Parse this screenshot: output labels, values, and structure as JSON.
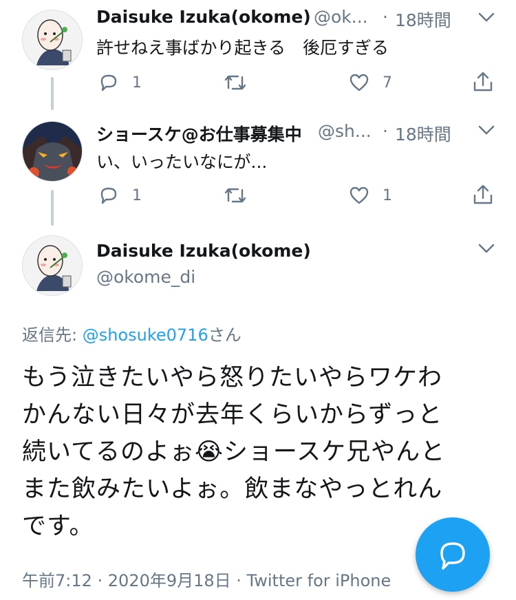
{
  "tweets": [
    {
      "name": "Daisuke Izuka(okome)",
      "handle": "@ok...",
      "time": "18時間",
      "text": "許せねえ事ばかり起きる　後厄すぎる",
      "reply_count": "1",
      "like_count": "7"
    },
    {
      "name": "ショースケ@お仕事募集中",
      "handle": "@sh...",
      "time": "18時間",
      "text": "い、いったいなにが...",
      "reply_count": "1",
      "like_count": "1"
    }
  ],
  "main_tweet": {
    "name": "Daisuke Izuka(okome)",
    "handle": "@okome_di",
    "reply_to_label": "返信先:",
    "reply_to_handle": "@shosuke0716",
    "reply_to_suffix": "さん",
    "body_lines": [
      "もう泣きたいやら怒りたいやらワケわ",
      "かんない日々が去年くらいからずっと",
      "続いてるのよぉ",
      "ショースケ兄やんと",
      "また飲みたいよぉ。飲まなやっとれん",
      "です。"
    ],
    "emoji": "😭",
    "footer": "午前7:12 · 2020年9月18日 · Twitter for iPhone"
  },
  "colors": {
    "accent": "#1da1f2",
    "secondary_text": "#657786",
    "thread_line": "#c4cfd6"
  },
  "icons": [
    "reply-icon",
    "retweet-icon",
    "like-icon",
    "share-icon",
    "chevron-down-icon",
    "compose-reply-icon"
  ]
}
